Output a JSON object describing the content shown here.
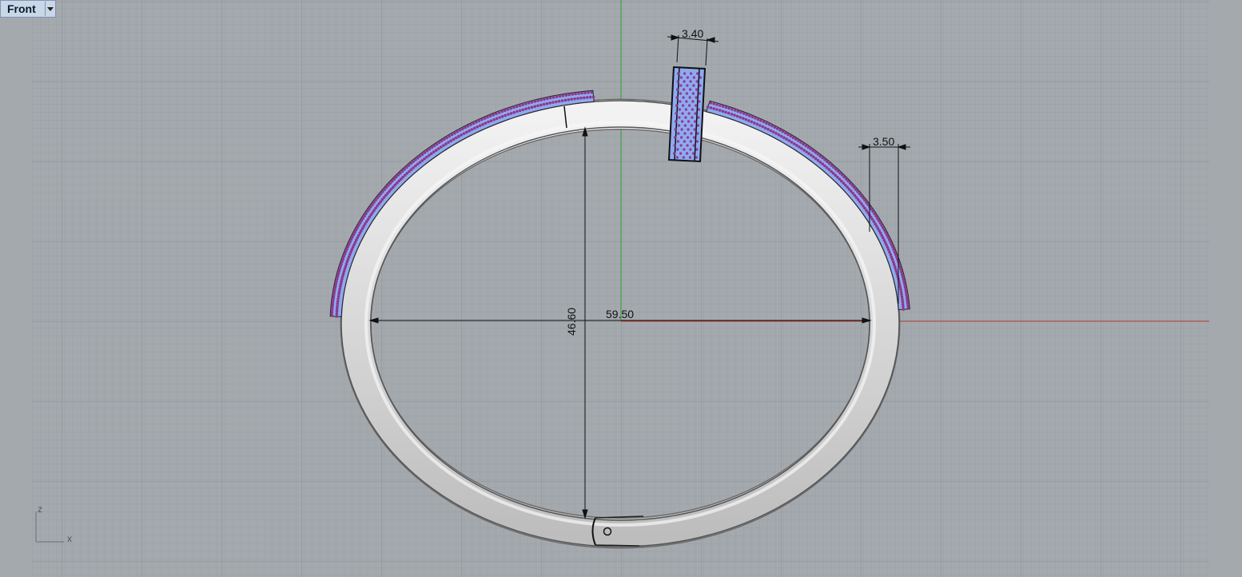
{
  "viewport": {
    "name": "Front",
    "dropdown_icon": "chevron-down-icon"
  },
  "dimensions": {
    "width": "59.50",
    "height": "46.60",
    "band_width": "3.40",
    "pave_thickness": "3.50"
  },
  "axis_widget": {
    "vertical": "z",
    "horizontal": "x"
  },
  "colors": {
    "background": "#a4a9ae",
    "grid_minor": "#9aa0a5",
    "grid_major": "#8a9095",
    "x_axis": "#b23a2e",
    "z_axis": "#2c9a2c",
    "metal": "#dcdcdc",
    "gem_fill": "#8fa9f0",
    "gem_dot": "#8a3a8a"
  }
}
